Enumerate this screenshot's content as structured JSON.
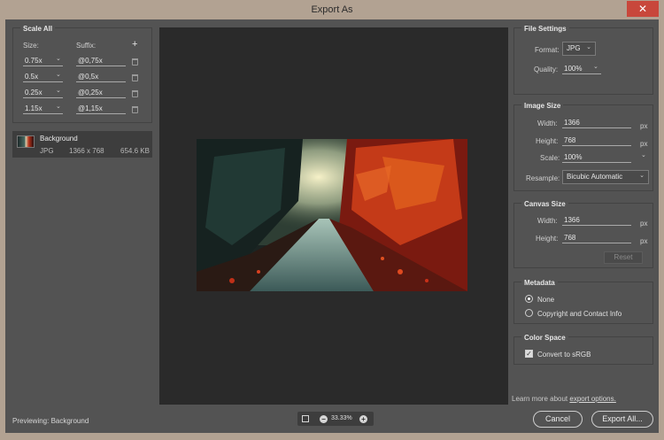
{
  "window": {
    "title": "Export As",
    "close_glyph": "✕"
  },
  "scale_all": {
    "title": "Scale All",
    "size_header": "Size:",
    "suffix_header": "Suffix:",
    "add_glyph": "+",
    "rows": [
      {
        "size": "0.75x",
        "suffix": "@0,75x"
      },
      {
        "size": "0.5x",
        "suffix": "@0,5x"
      },
      {
        "size": "0.25x",
        "suffix": "@0,25x"
      },
      {
        "size": "1.15x",
        "suffix": "@1,15x"
      }
    ]
  },
  "asset": {
    "name": "Background",
    "format": "JPG",
    "dimensions": "1366 x 768",
    "filesize": "654.6 KB"
  },
  "previewing": "Previewing: Background",
  "zoom": {
    "level": "33.33%",
    "minus_glyph": "−",
    "plus_glyph": "+"
  },
  "file_settings": {
    "title": "File Settings",
    "format_label": "Format:",
    "format_value": "JPG",
    "quality_label": "Quality:",
    "quality_value": "100%"
  },
  "image_size": {
    "title": "Image Size",
    "width_label": "Width:",
    "width_value": "1366",
    "width_unit": "px",
    "height_label": "Height:",
    "height_value": "768",
    "height_unit": "px",
    "scale_label": "Scale:",
    "scale_value": "100%",
    "resample_label": "Resample:",
    "resample_value": "Bicubic Automatic"
  },
  "canvas_size": {
    "title": "Canvas Size",
    "width_label": "Width:",
    "width_value": "1366",
    "width_unit": "px",
    "height_label": "Height:",
    "height_value": "768",
    "height_unit": "px",
    "reset_label": "Reset"
  },
  "metadata": {
    "title": "Metadata",
    "option_none": "None",
    "option_copyright": "Copyright and Contact Info",
    "selected": "None"
  },
  "color_space": {
    "title": "Color Space",
    "convert_label": "Convert to sRGB",
    "checked": true
  },
  "learn_more": {
    "prefix": "Learn more about ",
    "link": "export options."
  },
  "buttons": {
    "cancel": "Cancel",
    "export_all": "Export All..."
  }
}
